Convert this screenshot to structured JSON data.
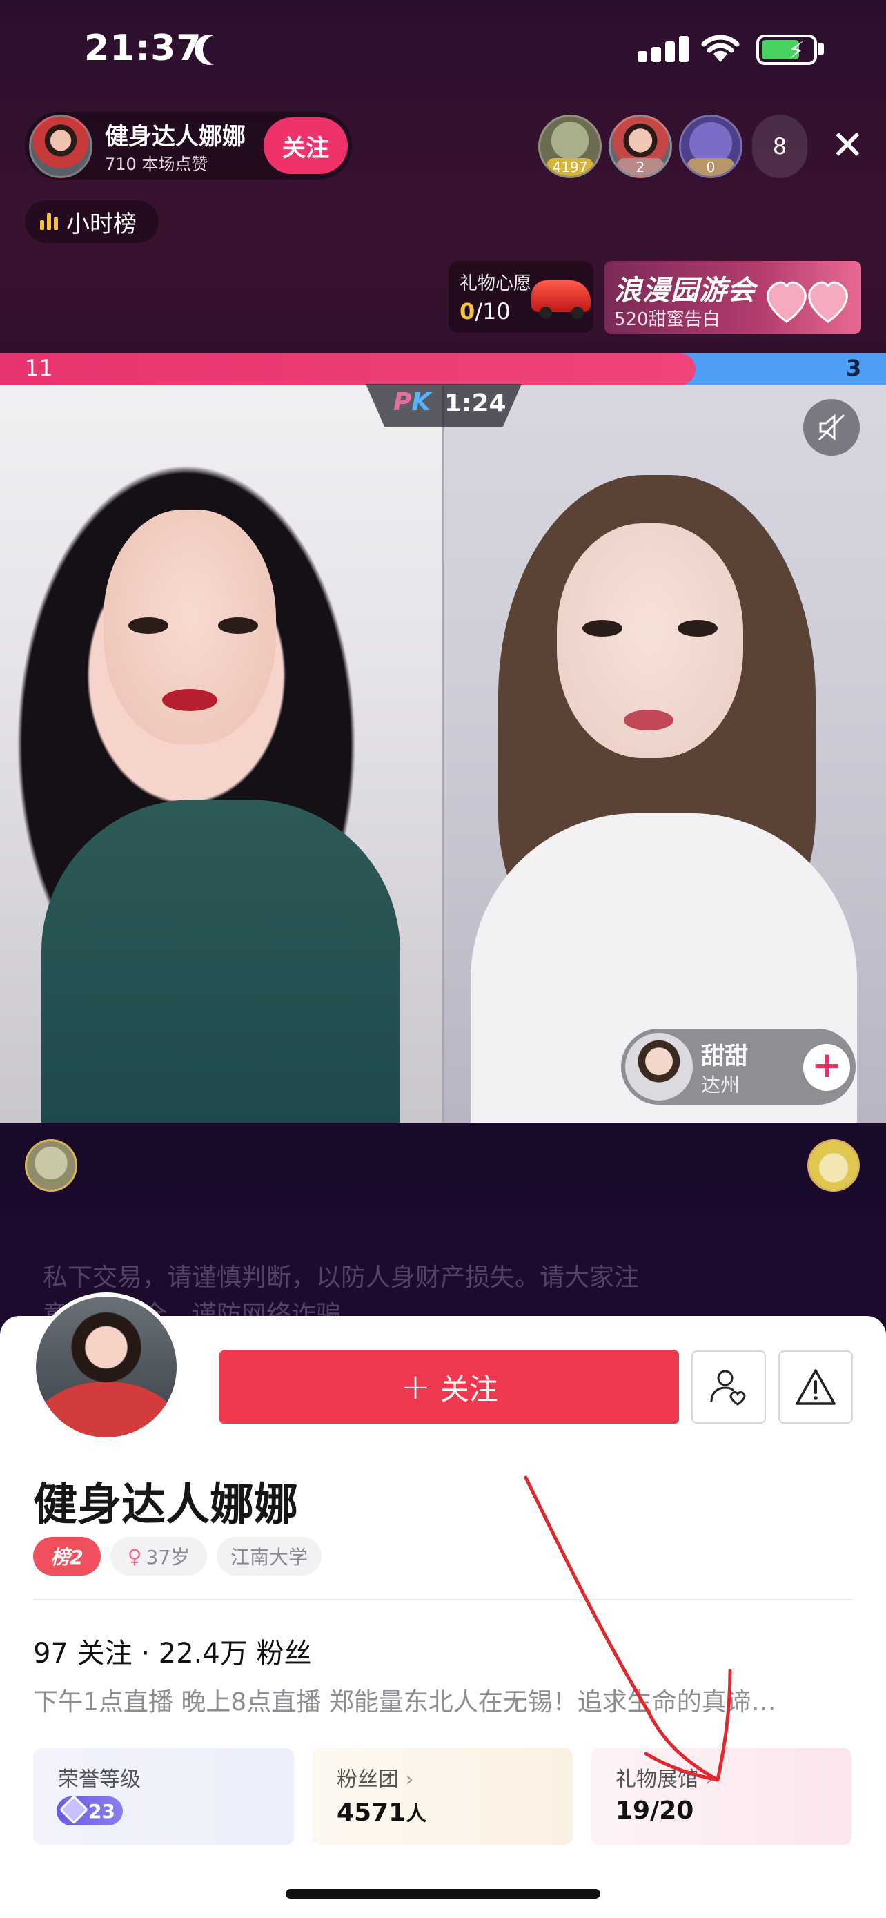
{
  "status_bar": {
    "time": "21:37"
  },
  "host": {
    "name": "健身达人娜娜",
    "likes": "710 本场点赞",
    "follow_label": "关注"
  },
  "viewers": {
    "badges": [
      "4197",
      "2",
      "0"
    ],
    "count": "8"
  },
  "rank_chip": "小时榜",
  "gift_wish": {
    "title": "礼物心愿",
    "progress_current": "0",
    "progress_total": "/10"
  },
  "banner": {
    "title": "浪漫园游会",
    "subtitle": "520甜蜜告白"
  },
  "pk": {
    "score_left": "11",
    "score_right": "3",
    "logo": "PK",
    "timer": "1:24",
    "left_share": 0.785
  },
  "opponent": {
    "name": "甜甜",
    "city": "达州"
  },
  "warning": {
    "line1": "私下交易，请谨慎判断，以防人身财产损失。请大家注",
    "line2": "意财产安全，谨防网络诈骗"
  },
  "profile": {
    "follow_button": "关注",
    "name": "健身达人娜娜",
    "rank_tag": "榜2",
    "age_tag": "37岁",
    "school_tag": "江南大学",
    "stats": "97 关注 · 22.4万 粉丝",
    "bio": "下午1点直播 晚上8点直播 郑能量东北人在无锡！追求生命的真谛…",
    "cards": {
      "honor": {
        "title": "荣誉等级",
        "level": "23"
      },
      "fans": {
        "title": "粉丝团",
        "value": "4571",
        "unit": "人"
      },
      "gift": {
        "title": "礼物展馆",
        "value": "19/20"
      }
    }
  },
  "colors": {
    "accent": "#f0384f",
    "pk_red": "#e8346e",
    "pk_blue": "#4f9ef5"
  }
}
